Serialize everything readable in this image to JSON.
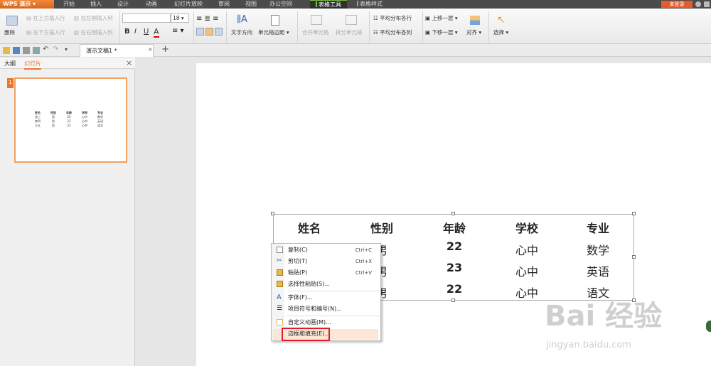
{
  "app": {
    "name": "WPS 演示",
    "login": "未登录"
  },
  "menu_tabs": [
    {
      "label": "开始"
    },
    {
      "label": "插入"
    },
    {
      "label": "设计"
    },
    {
      "label": "动画"
    },
    {
      "label": "幻灯片放映"
    },
    {
      "label": "审阅"
    },
    {
      "label": "视图"
    },
    {
      "label": "办公空间"
    },
    {
      "label": "表格工具"
    },
    {
      "label": "表格样式"
    }
  ],
  "ribbon": {
    "delete": "删除",
    "insert_above": "在上方插入行",
    "insert_left": "在左侧插入列",
    "insert_below": "在下方插入行",
    "insert_right": "在右侧插入列",
    "font_size": "18",
    "bold": "B",
    "italic": "I",
    "underline": "U",
    "font_color": "A",
    "text_direction": "文字方向",
    "cell_margin": "单元格边距",
    "merge_cells": "合并单元格",
    "split_cells": "拆分单元格",
    "distribute_rows": "平均分布各行",
    "distribute_cols": "平均分布各列",
    "bring_forward": "上移一层",
    "send_backward": "下移一层",
    "align": "对齐",
    "select": "选择"
  },
  "quick_toolbar": {
    "doc_tab": "演示文稿1 *",
    "add_tab": "+"
  },
  "side_panel": {
    "tab_outline": "大纲",
    "tab_slides": "幻灯片",
    "close": "×",
    "slide_number": "1"
  },
  "table": {
    "headers": [
      "姓名",
      "性别",
      "年龄",
      "学校",
      "专业"
    ],
    "rows": [
      [
        "张三",
        "男",
        "22",
        "心中",
        "数学"
      ],
      [
        "李四",
        "男",
        "23",
        "心中",
        "英语"
      ],
      [
        "王五",
        "男",
        "22",
        "心中",
        "语文"
      ]
    ]
  },
  "context_menu": {
    "items": [
      {
        "label": "复制(C)",
        "shortcut": "Ctrl+C",
        "icon": "copy-icon"
      },
      {
        "label": "剪切(T)",
        "shortcut": "Ctrl+X",
        "icon": "cut-icon"
      },
      {
        "label": "粘贴(P)",
        "shortcut": "Ctrl+V",
        "icon": "paste-icon"
      },
      {
        "label": "选择性粘贴(S)...",
        "shortcut": "",
        "icon": "paste-special-icon"
      },
      {
        "label": "字体(F)...",
        "shortcut": "",
        "icon": "font-icon"
      },
      {
        "label": "项目符号和编号(N)...",
        "shortcut": "",
        "icon": "bullets-icon"
      },
      {
        "label": "自定义动画(M)...",
        "shortcut": "",
        "icon": "animation-icon"
      },
      {
        "label": "边框和填充(E)...",
        "shortcut": "",
        "icon": "border-icon"
      }
    ]
  },
  "watermark": {
    "logo": "Bai 经验",
    "url": "jingyan.baidu.com"
  },
  "colors": {
    "accent": "#e8772e",
    "highlight": "#d9202a",
    "tab_green": "#7ac143"
  }
}
